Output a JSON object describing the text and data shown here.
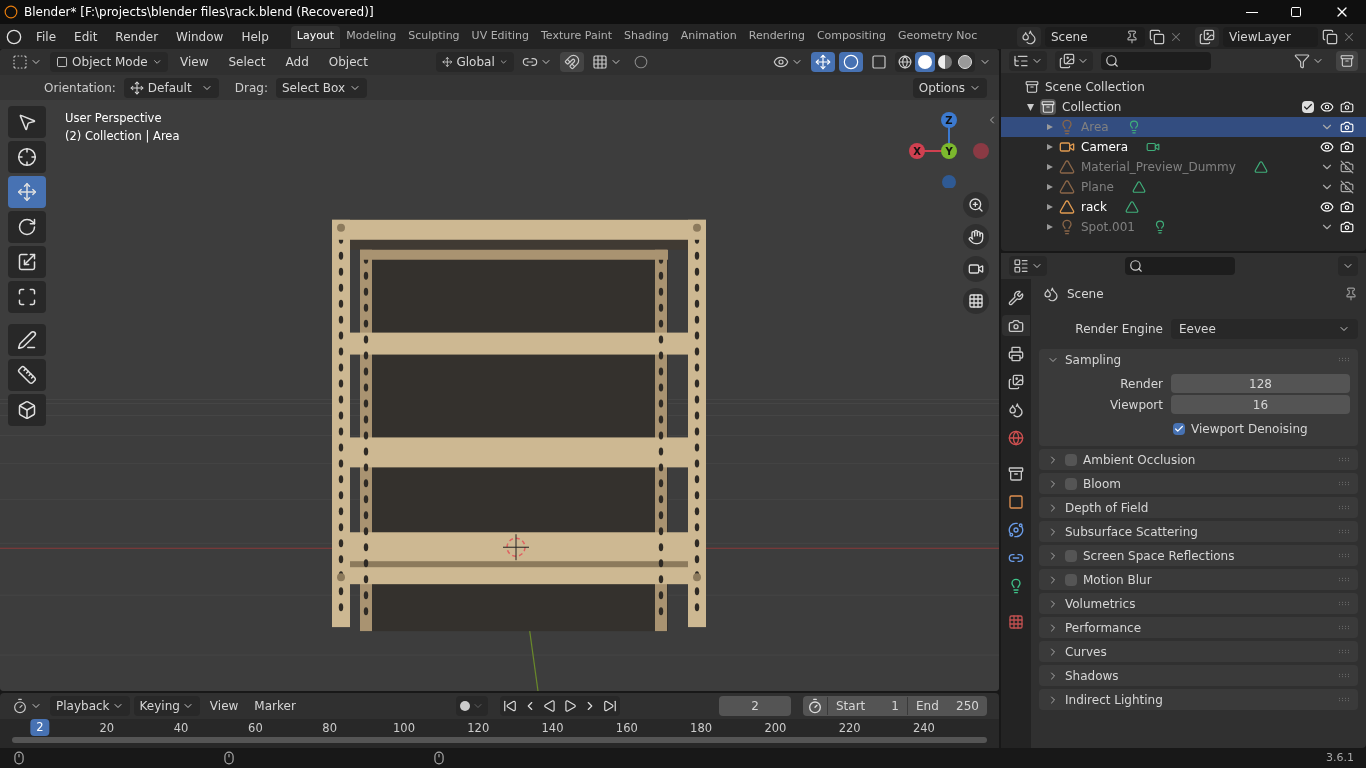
{
  "window": {
    "title": "Blender* [F:\\projects\\blender files\\rack.blend (Recovered)]"
  },
  "menu": [
    "File",
    "Edit",
    "Render",
    "Window",
    "Help"
  ],
  "workspaces": [
    {
      "label": "Layout",
      "selected": true
    },
    {
      "label": "Modeling",
      "selected": false
    },
    {
      "label": "Sculpting",
      "selected": false
    },
    {
      "label": "UV Editing",
      "selected": false
    },
    {
      "label": "Texture Paint",
      "selected": false
    },
    {
      "label": "Shading",
      "selected": false
    },
    {
      "label": "Animation",
      "selected": false
    },
    {
      "label": "Rendering",
      "selected": false
    },
    {
      "label": "Compositing",
      "selected": false
    },
    {
      "label": "Geometry Noc",
      "selected": false
    }
  ],
  "scene": "Scene",
  "view_layer": "ViewLayer",
  "viewport_header": {
    "mode": "Object Mode",
    "menus": [
      "View",
      "Select",
      "Add",
      "Object"
    ],
    "orientation": "Global",
    "shading": [
      {
        "kind": "wireframe",
        "selected": false
      },
      {
        "kind": "solid",
        "selected": true
      },
      {
        "kind": "material",
        "selected": false
      },
      {
        "kind": "rendered",
        "selected": false
      }
    ]
  },
  "tool_settings": {
    "orientation_label": "Orientation:",
    "orientation": "Default",
    "drag_label": "Drag:",
    "drag": "Select Box",
    "options": "Options"
  },
  "tools": [
    {
      "kind": "select",
      "selected": false
    },
    {
      "kind": "cursor",
      "selected": false
    },
    {
      "kind": "move",
      "selected": true
    },
    {
      "kind": "rotate",
      "selected": false
    },
    {
      "kind": "scale",
      "selected": false
    },
    {
      "kind": "transform",
      "selected": false
    },
    {
      "kind": "annotate",
      "selected": false
    },
    {
      "kind": "measure",
      "selected": false
    },
    {
      "kind": "add_cube",
      "selected": false
    }
  ],
  "viewport": {
    "view_name": "User Perspective",
    "context": "(2) Collection | Area",
    "gizmo": {
      "x": "X",
      "y": "Y",
      "z": "Z"
    }
  },
  "outliner": {
    "root": "Scene Collection",
    "collection": {
      "label": "Collection",
      "expanded": true,
      "checked": true,
      "children": [
        {
          "label": "Area",
          "kind": "light",
          "selected": true,
          "visible": false,
          "renderable": true
        },
        {
          "label": "Camera",
          "kind": "camera",
          "selected": false,
          "visible": true,
          "renderable": true
        },
        {
          "label": "Material_Preview_Dummy",
          "kind": "mesh",
          "selected": false,
          "visible": false,
          "renderable": false
        },
        {
          "label": "Plane",
          "kind": "mesh",
          "selected": false,
          "visible": false,
          "renderable": false
        },
        {
          "label": "rack",
          "kind": "mesh",
          "selected": false,
          "visible": true,
          "renderable": true
        },
        {
          "label": "Spot.001",
          "kind": "light",
          "selected": false,
          "visible": false,
          "renderable": true
        }
      ]
    }
  },
  "properties": {
    "tabs": [
      {
        "kind": "tool",
        "selected": false
      },
      {
        "kind": "render",
        "selected": true
      },
      {
        "kind": "output",
        "selected": false
      },
      {
        "kind": "view_layer",
        "selected": false
      },
      {
        "kind": "scene",
        "selected": false
      },
      {
        "kind": "world",
        "selected": false
      },
      {
        "kind": "collection",
        "selected": false
      },
      {
        "kind": "object",
        "selected": false
      },
      {
        "kind": "physics",
        "selected": false
      },
      {
        "kind": "constraints",
        "selected": false
      },
      {
        "kind": "data",
        "selected": false
      },
      {
        "kind": "texture",
        "selected": false
      }
    ],
    "title": "Scene",
    "render_engine_label": "Render Engine",
    "render_engine": "Eevee",
    "panels": [
      {
        "label": "Sampling",
        "expanded": true,
        "fields": [
          {
            "label": "Render",
            "value": "128"
          },
          {
            "label": "Viewport",
            "value": "16"
          }
        ],
        "checkbox": {
          "label": "Viewport Denoising",
          "checked": true
        }
      },
      {
        "label": "Ambient Occlusion",
        "expanded": false,
        "toggle": true,
        "checked": false
      },
      {
        "label": "Bloom",
        "expanded": false,
        "toggle": true,
        "checked": false
      },
      {
        "label": "Depth of Field",
        "expanded": false,
        "toggle": false
      },
      {
        "label": "Subsurface Scattering",
        "expanded": false,
        "toggle": false
      },
      {
        "label": "Screen Space Reflections",
        "expanded": false,
        "toggle": true,
        "checked": false
      },
      {
        "label": "Motion Blur",
        "expanded": false,
        "toggle": true,
        "checked": false
      },
      {
        "label": "Volumetrics",
        "expanded": false,
        "toggle": false
      },
      {
        "label": "Performance",
        "expanded": false,
        "toggle": false
      },
      {
        "label": "Curves",
        "expanded": false,
        "toggle": false
      },
      {
        "label": "Shadows",
        "expanded": false,
        "toggle": false
      },
      {
        "label": "Indirect Lighting",
        "expanded": false,
        "toggle": false
      }
    ]
  },
  "timeline": {
    "menus": [
      {
        "label": "Playback",
        "dropdown": true
      },
      {
        "label": "Keying",
        "dropdown": true
      },
      {
        "label": "View",
        "dropdown": false
      },
      {
        "label": "Marker",
        "dropdown": false
      }
    ],
    "current_frame": "2",
    "start_label": "Start",
    "start": "1",
    "end_label": "End",
    "end": "250",
    "ruler": [
      "20",
      "40",
      "60",
      "80",
      "100",
      "120",
      "140",
      "160",
      "180",
      "200",
      "220",
      "240"
    ],
    "ruler_marker": "2"
  },
  "status_bar": {
    "version": "3.6.1"
  }
}
